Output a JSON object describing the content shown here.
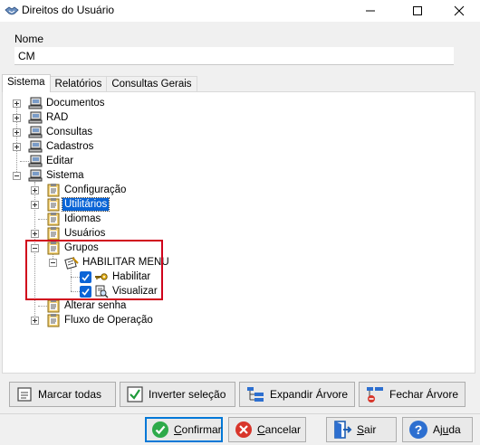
{
  "window": {
    "title": "Direitos do Usuário"
  },
  "form": {
    "nome_label": "Nome",
    "nome_value": "CM"
  },
  "tabs": [
    {
      "label": "Sistema",
      "active": true
    },
    {
      "label": "Relatórios",
      "active": false
    },
    {
      "label": "Consultas Gerais",
      "active": false
    }
  ],
  "tree": {
    "documentos": "Documentos",
    "rad": "RAD",
    "consultas": "Consultas",
    "cadastros": "Cadastros",
    "editar": "Editar",
    "sistema": "Sistema",
    "configuracao": "Configuração",
    "utilitarios": "Utilitários",
    "idiomas": "Idiomas",
    "usuarios": "Usuários",
    "grupos": "Grupos",
    "habilitar_menu": "HABILITAR MENU",
    "habilitar": "Habilitar",
    "visualizar": "Visualizar",
    "alterar_senha": "Alterar senha",
    "fluxo_operacao": "Fluxo de Operação"
  },
  "actions": {
    "marcar_todas": "Marcar todas",
    "inverter_selecao": "Inverter seleção",
    "expandir_arvore": "Expandir Árvore",
    "fechar_arvore": "Fechar Árvore"
  },
  "footer": {
    "confirmar_first": "C",
    "confirmar_rest": "onfirmar",
    "cancelar_first": "C",
    "cancelar_rest": "ancelar",
    "sair_first": "S",
    "sair_rest": "air",
    "ajuda_first": "Aj",
    "ajuda_u": "u",
    "ajuda_rest": "da"
  },
  "colors": {
    "accent": "#0a64d6",
    "highlight_box": "#d0021b",
    "button_focus": "#0078d7"
  }
}
